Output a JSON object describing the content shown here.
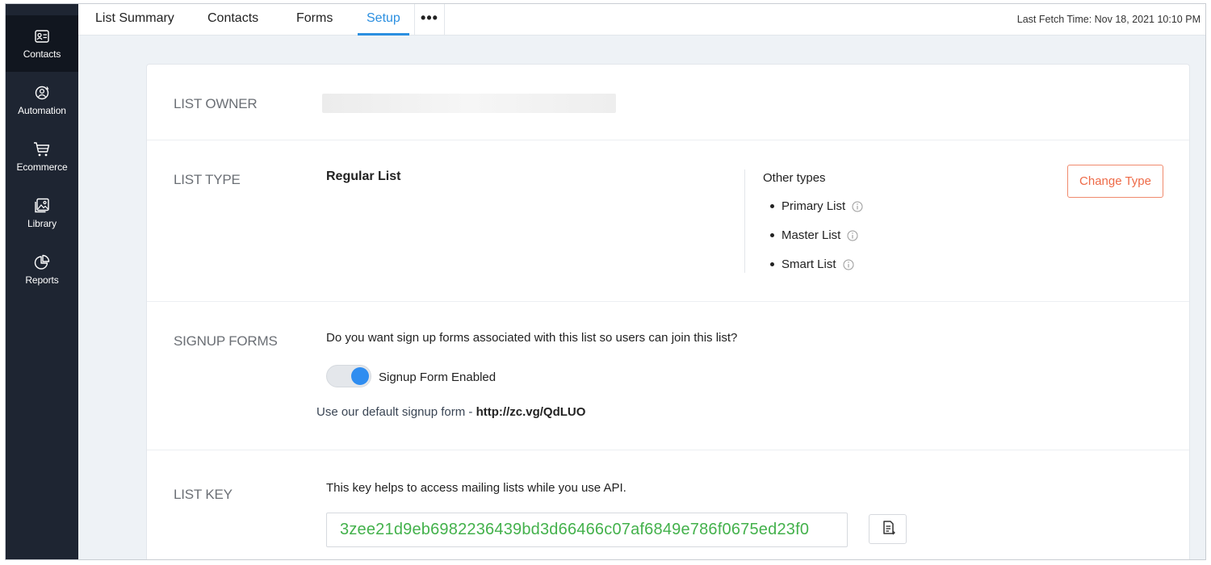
{
  "sidebar": {
    "items": [
      {
        "label": "Contacts",
        "icon": "contact-card-icon",
        "active": true
      },
      {
        "label": "Automation",
        "icon": "automation-icon",
        "active": false
      },
      {
        "label": "Ecommerce",
        "icon": "cart-icon",
        "active": false
      },
      {
        "label": "Library",
        "icon": "image-library-icon",
        "active": false
      },
      {
        "label": "Reports",
        "icon": "pie-chart-icon",
        "active": false
      }
    ]
  },
  "topbar": {
    "tabs": [
      {
        "label": "List Summary",
        "active": false
      },
      {
        "label": "Contacts",
        "active": false
      },
      {
        "label": "Forms",
        "active": false
      },
      {
        "label": "Setup",
        "active": true
      }
    ],
    "more_label": "•••",
    "fetch_time": "Last Fetch Time:  Nov 18, 2021 10:10 PM"
  },
  "list_owner": {
    "label": "LIST OWNER"
  },
  "list_type": {
    "label": "LIST TYPE",
    "current": "Regular List",
    "other_title": "Other types",
    "others": [
      "Primary List",
      "Master List",
      "Smart List"
    ],
    "change_button": "Change Type"
  },
  "signup_forms": {
    "label": "SIGNUP FORMS",
    "question": "Do you want sign up forms associated with this list so users can join this list?",
    "toggle_label": "Signup Form Enabled",
    "toggle_on": true,
    "default_prefix": "Use our default signup form - ",
    "default_link": "http://zc.vg/QdLUO"
  },
  "list_key": {
    "label": "LIST KEY",
    "help": "This key helps to access mailing lists while you use API.",
    "value": "3zee21d9eb6982236439bd3d66466c07af6849e786f0675ed23f0"
  },
  "colors": {
    "sidebar_bg": "#1e2532",
    "accent_blue": "#2b8fe0",
    "change_type_orange": "#ee6a47",
    "key_green": "#43b14b"
  }
}
